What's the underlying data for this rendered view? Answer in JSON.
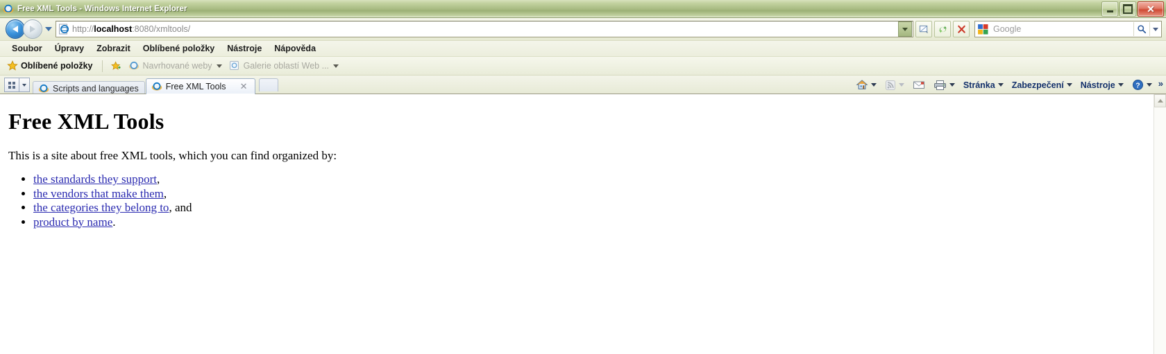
{
  "window": {
    "title": "Free XML Tools - Windows Internet Explorer",
    "icon": "ie-logo-icon",
    "minimize_label": "Minimalizovat",
    "maximize_label": "Maximalizovat",
    "close_label": "Zavřít"
  },
  "navigation": {
    "back_label": "Zpět",
    "forward_label": "Vpřed",
    "history_label": "Poslední stránky",
    "address": {
      "protocol": "http://",
      "host": "localhost",
      "rest": ":8080/xmltools/",
      "full": "http://localhost:8080/xmltools/"
    },
    "buttons": {
      "compatibility": "Zobrazení kompatibility",
      "refresh": "Obnovit",
      "stop": "Zastavit"
    },
    "search": {
      "provider": "Google",
      "placeholder": "Google",
      "go_label": "Hledat"
    }
  },
  "menubar": {
    "items": [
      {
        "label": "Soubor"
      },
      {
        "label": "Úpravy"
      },
      {
        "label": "Zobrazit"
      },
      {
        "label": "Oblíbené položky"
      },
      {
        "label": "Nástroje"
      },
      {
        "label": "Nápověda"
      }
    ]
  },
  "favoritesbar": {
    "main_label": "Oblíbené položky",
    "items": [
      {
        "label": "Navrhované weby",
        "has_caret": true
      },
      {
        "label": "Galerie oblastí Web ...",
        "has_caret": true
      }
    ]
  },
  "tabs": {
    "quicktabs_label": "Rychlé karty",
    "tablist_label": "Seznam karet",
    "newtab_label": "Nová karta",
    "close_glyph": "✕",
    "items": [
      {
        "label": "Scripts and languages",
        "active": false
      },
      {
        "label": "Free XML Tools",
        "active": true
      }
    ]
  },
  "command_bar": {
    "home_label": "Domovská stránka",
    "feeds_label": "Kanály",
    "mail_label": "Číst poštu",
    "print_label": "Tisk",
    "items": [
      {
        "label": "Stránka"
      },
      {
        "label": "Zabezpečení"
      },
      {
        "label": "Nástroje"
      }
    ],
    "help_label": "Nápověda",
    "overflow_glyph": "»"
  },
  "page": {
    "heading": "Free XML Tools",
    "intro": "This is a site about free XML tools, which you can find organized by:",
    "list": [
      {
        "link": "the standards they support",
        "tail": ","
      },
      {
        "link": "the vendors that make them",
        "tail": ","
      },
      {
        "link": "the categories they belong to",
        "tail": ", and"
      },
      {
        "link": "product by name",
        "tail": "."
      }
    ],
    "link_color": "#2a2ab0",
    "text_color": "#000000"
  }
}
